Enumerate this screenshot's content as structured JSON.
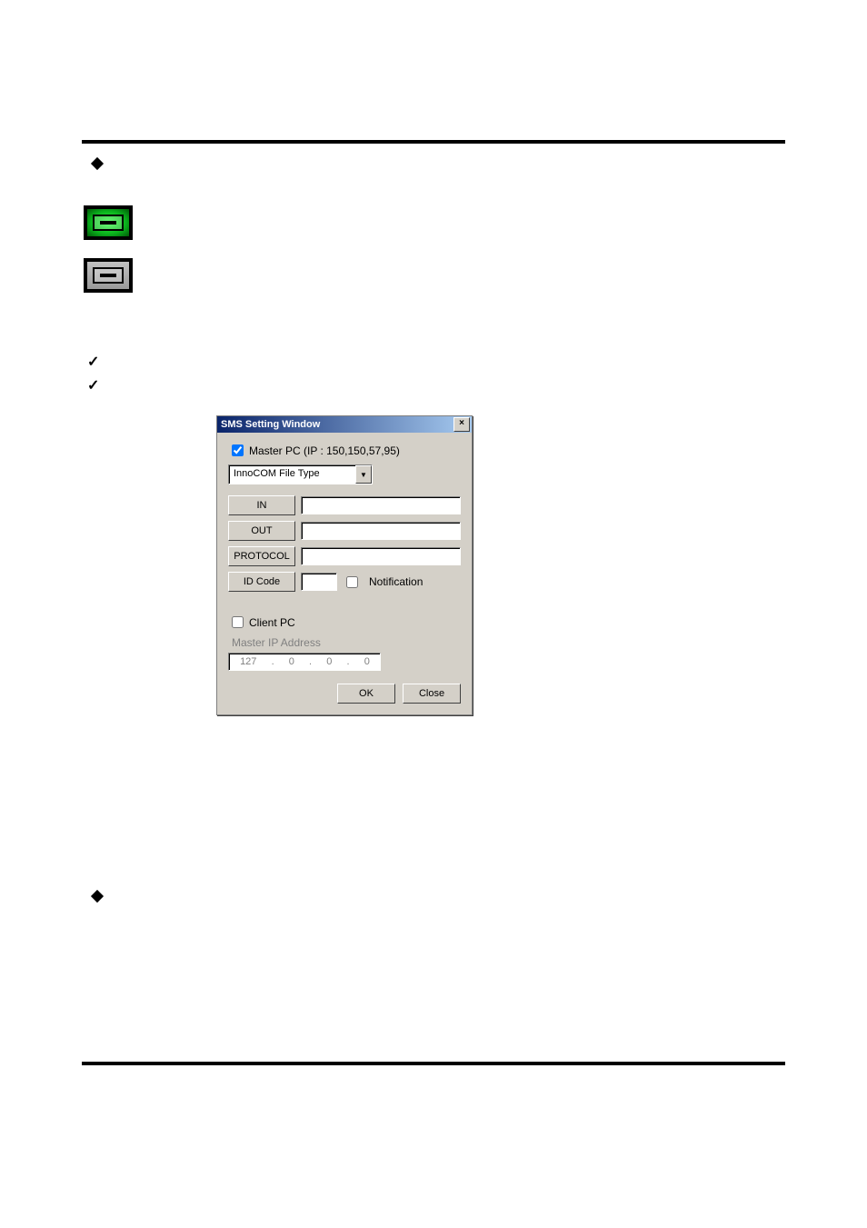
{
  "dialog": {
    "title": "SMS Setting Window",
    "close_x": "×",
    "master_checked": true,
    "master_label": "Master PC (IP : 150,150,57,95)",
    "file_type": "InnoCOM File Type",
    "fields": {
      "in": {
        "btn": "IN",
        "value": ""
      },
      "out": {
        "btn": "OUT",
        "value": ""
      },
      "protocol": {
        "btn": "PROTOCOL",
        "value": ""
      },
      "idcode": {
        "btn": "ID Code",
        "value": ""
      }
    },
    "notif_checked": false,
    "notif_label": "Notification",
    "client_checked": false,
    "client_label": "Client PC",
    "master_ip_label": "Master IP Address",
    "master_ip": [
      "127",
      "0",
      "0",
      "0"
    ],
    "ok": "OK",
    "close": "Close"
  }
}
